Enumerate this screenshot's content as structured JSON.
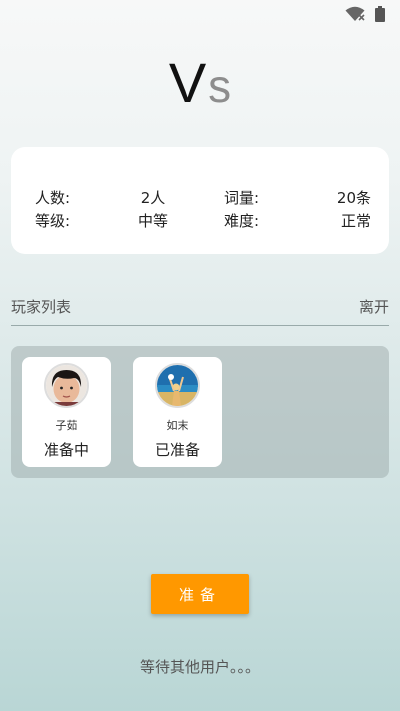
{
  "status_bar": {
    "icons": [
      "wifi-icon",
      "battery-icon"
    ]
  },
  "header": {
    "title_v": "V",
    "title_s": "s"
  },
  "room_info": {
    "player_count_label": "人数:",
    "player_count_value": "2人",
    "word_count_label": "词量:",
    "word_count_value": "20条",
    "level_label": "等级:",
    "level_value": "中等",
    "difficulty_label": "难度:",
    "difficulty_value": "正常"
  },
  "players_section": {
    "title": "玩家列表",
    "leave_label": "离开"
  },
  "players": [
    {
      "name": "子茹",
      "status": "准备中",
      "avatar": "child-photo-avatar"
    },
    {
      "name": "如末",
      "status": "已准备",
      "avatar": "beach-photo-avatar"
    }
  ],
  "ready_button_label": "准备",
  "waiting_text": "等待其他用户。。。",
  "colors": {
    "accent": "#ff9800",
    "card": "#ffffff",
    "panel": "#a9b8b7"
  }
}
